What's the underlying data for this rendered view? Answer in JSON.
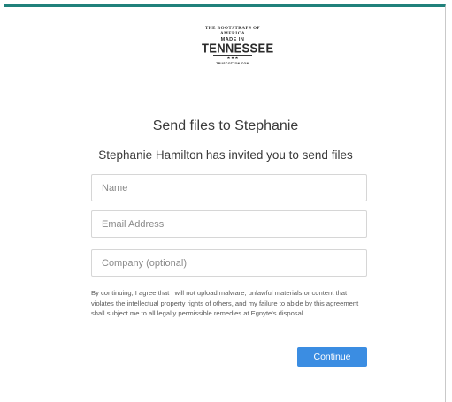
{
  "logo": {
    "arc_text": "THE BOOTSTRAPS OF AMERICA",
    "made_text": "MADE IN",
    "main_text": "TENNESSEE",
    "stars": "★★★",
    "url_text": "TRUSCOTTON.COM"
  },
  "title": "Send files to Stephanie",
  "subtitle": "Stephanie Hamilton has invited you to send files",
  "form": {
    "name_placeholder": "Name",
    "name_value": "",
    "email_placeholder": "Email Address",
    "email_value": "",
    "company_placeholder": "Company (optional)",
    "company_value": ""
  },
  "terms": "By continuing, I agree that I will not upload malware, unlawful materials or content that violates the intellectual property rights of others, and my failure to abide by this agreement shall subject me to all legally permissible remedies at Egnyte's disposal.",
  "continue_label": "Continue",
  "colors": {
    "top_bar": "#20817b",
    "button": "#3b8de2"
  }
}
